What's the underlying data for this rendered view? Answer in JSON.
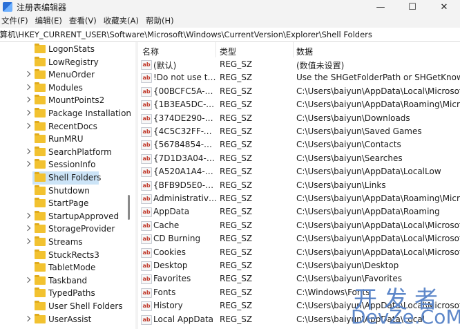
{
  "window": {
    "title": "注册表编辑器",
    "minimize_glyph": "—",
    "maximize_glyph": "☐",
    "close_glyph": "✕",
    "icon": "registry-editor-icon"
  },
  "menu": [
    "文件(F)",
    "编辑(E)",
    "查看(V)",
    "收藏夹(A)",
    "帮助(H)"
  ],
  "address": "计算机\\HKEY_CURRENT_USER\\Software\\Microsoft\\Windows\\CurrentVersion\\Explorer\\Shell Folders",
  "tree": {
    "items": [
      {
        "label": "LogonStats",
        "expandable": false
      },
      {
        "label": "LowRegistry",
        "expandable": false
      },
      {
        "label": "MenuOrder",
        "expandable": true
      },
      {
        "label": "Modules",
        "expandable": true
      },
      {
        "label": "MountPoints2",
        "expandable": true
      },
      {
        "label": "Package Installation",
        "expandable": true
      },
      {
        "label": "RecentDocs",
        "expandable": true
      },
      {
        "label": "RunMRU",
        "expandable": false
      },
      {
        "label": "SearchPlatform",
        "expandable": true
      },
      {
        "label": "SessionInfo",
        "expandable": true
      },
      {
        "label": "Shell Folders",
        "expandable": false,
        "selected": true
      },
      {
        "label": "Shutdown",
        "expandable": false
      },
      {
        "label": "StartPage",
        "expandable": false
      },
      {
        "label": "StartupApproved",
        "expandable": true
      },
      {
        "label": "StorageProvider",
        "expandable": true
      },
      {
        "label": "Streams",
        "expandable": true
      },
      {
        "label": "StuckRects3",
        "expandable": false
      },
      {
        "label": "TabletMode",
        "expandable": false
      },
      {
        "label": "Taskband",
        "expandable": true
      },
      {
        "label": "TypedPaths",
        "expandable": false
      },
      {
        "label": "User Shell Folders",
        "expandable": false
      },
      {
        "label": "UserAssist",
        "expandable": true
      }
    ],
    "selected_color": "#cce4f7",
    "folder_color": "#f2c230"
  },
  "list": {
    "columns": [
      "名称",
      "类型",
      "数据"
    ],
    "value_icon_text": "ab",
    "rows": [
      {
        "name": "(默认)",
        "type": "REG_SZ",
        "data": "(数值未设置)"
      },
      {
        "name": "!Do not use thi...",
        "type": "REG_SZ",
        "data": "Use the SHGetFolderPath or SHGetKnownFo"
      },
      {
        "name": "{00BCFC5A-ED...",
        "type": "REG_SZ",
        "data": "C:\\Users\\baiyun\\AppData\\Local\\Microsoft\\W"
      },
      {
        "name": "{1B3EA5DC-B5...",
        "type": "REG_SZ",
        "data": "C:\\Users\\baiyun\\AppData\\Roaming\\Microso"
      },
      {
        "name": "{374DE290-12...",
        "type": "REG_SZ",
        "data": "C:\\Users\\baiyun\\Downloads"
      },
      {
        "name": "{4C5C32FF-BB...",
        "type": "REG_SZ",
        "data": "C:\\Users\\baiyun\\Saved Games"
      },
      {
        "name": "{56784854-C6...",
        "type": "REG_SZ",
        "data": "C:\\Users\\baiyun\\Contacts"
      },
      {
        "name": "{7D1D3A04-DE...",
        "type": "REG_SZ",
        "data": "C:\\Users\\baiyun\\Searches"
      },
      {
        "name": "{A520A1A4-17...",
        "type": "REG_SZ",
        "data": "C:\\Users\\baiyun\\AppData\\LocalLow"
      },
      {
        "name": "{BFB9D5E0-C6...",
        "type": "REG_SZ",
        "data": "C:\\Users\\baiyun\\Links"
      },
      {
        "name": "Administrative ...",
        "type": "REG_SZ",
        "data": "C:\\Users\\baiyun\\AppData\\Roaming\\Microso"
      },
      {
        "name": "AppData",
        "type": "REG_SZ",
        "data": "C:\\Users\\baiyun\\AppData\\Roaming"
      },
      {
        "name": "Cache",
        "type": "REG_SZ",
        "data": "C:\\Users\\baiyun\\AppData\\Local\\Microsoft\\W"
      },
      {
        "name": "CD Burning",
        "type": "REG_SZ",
        "data": "C:\\Users\\baiyun\\AppData\\Local\\Microsoft\\W"
      },
      {
        "name": "Cookies",
        "type": "REG_SZ",
        "data": "C:\\Users\\baiyun\\AppData\\Local\\Microsoft\\W"
      },
      {
        "name": "Desktop",
        "type": "REG_SZ",
        "data": "C:\\Users\\baiyun\\Desktop"
      },
      {
        "name": "Favorites",
        "type": "REG_SZ",
        "data": "C:\\Users\\baiyun\\Favorites"
      },
      {
        "name": "Fonts",
        "type": "REG_SZ",
        "data": "C:\\Windows\\Fonts"
      },
      {
        "name": "History",
        "type": "REG_SZ",
        "data": "C:\\Users\\baiyun\\AppData\\Local\\Microsoft\\W"
      },
      {
        "name": "Local AppData",
        "type": "REG_SZ",
        "data": "C:\\Users\\baiyun\\AppData\\Local"
      }
    ]
  },
  "watermark": {
    "cn": "开发者",
    "en": "DevZe.CoM",
    "color": "#5d87c9"
  }
}
